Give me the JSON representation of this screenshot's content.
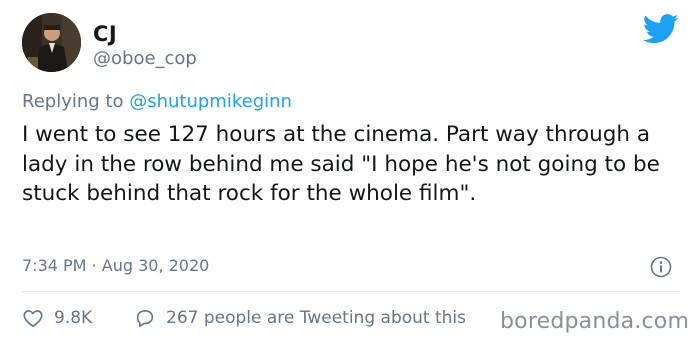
{
  "author": {
    "display_name": "CJ",
    "handle": "@oboe_cop"
  },
  "reply": {
    "prefix": "Replying to",
    "mention": "@shutupmikeginn"
  },
  "tweet": {
    "text": "I went to see 127 hours at the cinema. Part way through a lady in the row behind me said \"I hope he's not going to be stuck behind that rock for the whole film\"."
  },
  "meta": {
    "time": "7:34 PM",
    "separator": "·",
    "date": "Aug 30, 2020"
  },
  "actions": {
    "likes": "9.8K",
    "replies_text": "267 people are Tweeting about this"
  },
  "watermark": "boredpanda.com",
  "icons": {
    "brand": "twitter-bird-icon",
    "info": "info-icon",
    "like": "heart-icon",
    "reply": "comment-bubble-icon"
  },
  "colors": {
    "twitter_blue": "#1da1f2",
    "text_primary": "#14171a",
    "text_secondary": "#657786",
    "divider": "#e1e8ed"
  }
}
